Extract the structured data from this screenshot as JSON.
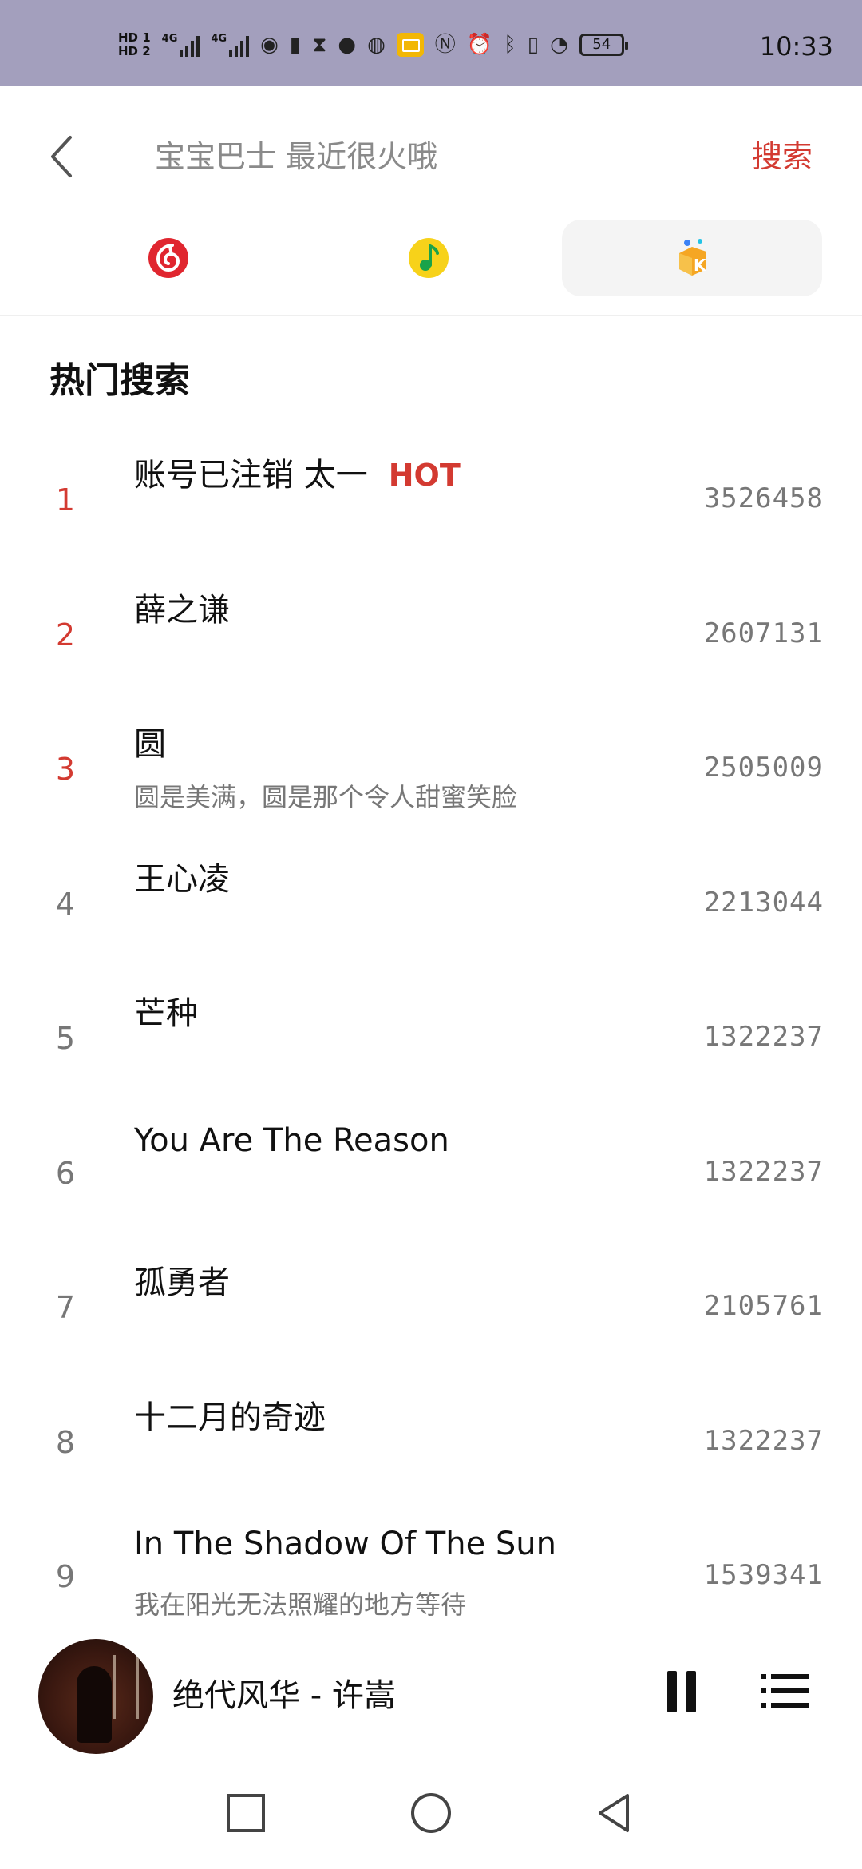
{
  "status_bar": {
    "hd1": "HD 1",
    "hd2": "HD 2",
    "net1": "4G",
    "net2": "4G",
    "battery": "54",
    "time": "10:33"
  },
  "header": {
    "placeholder": "宝宝巴士 最近很火哦",
    "search_label": "搜索"
  },
  "tabs": [
    {
      "name": "netease-music",
      "icon": "netease-cloud-music-icon",
      "color": "#e0262f",
      "active": false
    },
    {
      "name": "qq-music",
      "icon": "qq-music-icon",
      "color": "#f7d21a",
      "active": false
    },
    {
      "name": "kuwo-music",
      "icon": "kuwo-music-icon",
      "color": "#f5a623",
      "active": true
    }
  ],
  "hot_search": {
    "title": "热门搜索",
    "hot_tag": "HOT",
    "items": [
      {
        "rank": "1",
        "title": "账号已注销 太一",
        "hot": true,
        "subtitle": "",
        "count": "3526458"
      },
      {
        "rank": "2",
        "title": "薛之谦",
        "hot": false,
        "subtitle": "",
        "count": "2607131"
      },
      {
        "rank": "3",
        "title": "圆",
        "hot": false,
        "subtitle": "圆是美满，圆是那个令人甜蜜笑脸",
        "count": "2505009"
      },
      {
        "rank": "4",
        "title": "王心凌",
        "hot": false,
        "subtitle": "",
        "count": "2213044"
      },
      {
        "rank": "5",
        "title": "芒种",
        "hot": false,
        "subtitle": "",
        "count": "1322237"
      },
      {
        "rank": "6",
        "title": "You Are The Reason",
        "hot": false,
        "subtitle": "",
        "count": "1322237"
      },
      {
        "rank": "7",
        "title": "孤勇者",
        "hot": false,
        "subtitle": "",
        "count": "2105761"
      },
      {
        "rank": "8",
        "title": "十二月的奇迹",
        "hot": false,
        "subtitle": "",
        "count": "1322237"
      },
      {
        "rank": "9",
        "title": "In The Shadow Of The Sun",
        "hot": false,
        "subtitle": "我在阳光无法照耀的地方等待",
        "count": "1539341"
      }
    ]
  },
  "player": {
    "now_playing": "绝代风华 - 许嵩"
  },
  "colors": {
    "accent": "#d33a31",
    "status_bar": "#a39fbd",
    "muted_text": "#777777"
  }
}
